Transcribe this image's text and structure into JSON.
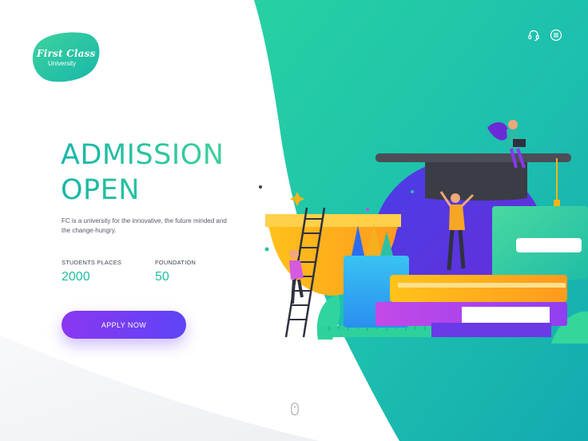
{
  "brand": {
    "title": "First Class",
    "subtitle": "University",
    "color": "#2cc7a5"
  },
  "header": {
    "icons": [
      "headset-icon",
      "menu-icon"
    ]
  },
  "hero": {
    "headline_line1": "ADMISSION",
    "headline_line2": "OPEN",
    "description": "FC is a university for the innovative, the future minded and the change-hungry.",
    "stats": [
      {
        "label": "STUDENTS PLACES",
        "value": "2000"
      },
      {
        "label": "FOUNDATION",
        "value": "50"
      }
    ],
    "cta_label": "APPLY NOW"
  },
  "colors": {
    "teal_start": "#1eb8a6",
    "teal_end": "#3dd59b",
    "button_start": "#8a37f0",
    "button_end": "#5e44f6",
    "text_dark": "#3c4452"
  },
  "footer": {
    "scroll_icon": "mouse-scroll-icon"
  }
}
